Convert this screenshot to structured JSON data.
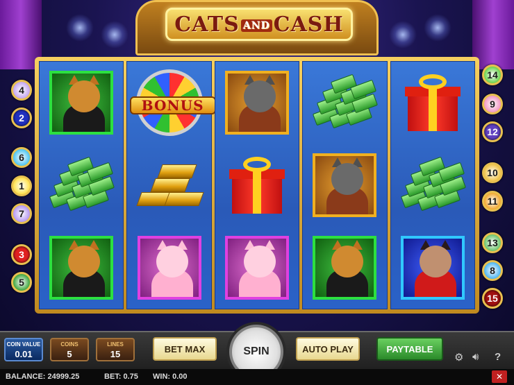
{
  "logo": {
    "part1": "CATS",
    "part2": "AND",
    "part3": "CASH"
  },
  "reels": [
    [
      "tabby-cat-green",
      "cash-stack",
      "tabby-cat-green"
    ],
    [
      "bonus-wheel",
      "gold-bars",
      "fluffy-cat-pink"
    ],
    [
      "grey-cat-gold",
      "gift-box",
      "fluffy-cat-pink"
    ],
    [
      "cash-stack",
      "grey-cat-gold",
      "tabby-cat-green"
    ],
    [
      "gift-box",
      "cash-stack",
      "lady-cat-blue"
    ]
  ],
  "bonus_label": "BONUS",
  "paylines_left": [
    "4",
    "2",
    "6",
    "1",
    "7",
    "3",
    "5"
  ],
  "paylines_right": [
    "14",
    "9",
    "12",
    "10",
    "11",
    "13",
    "8",
    "15"
  ],
  "controls": {
    "coin_value_label": "COIN VALUE",
    "coin_value": "0.01",
    "coins_label": "COINS",
    "coins": "5",
    "lines_label": "LINES",
    "lines": "15",
    "bet_max": "BET MAX",
    "spin": "SPIN",
    "auto_play": "AUTO PLAY",
    "paytable": "PAYTABLE"
  },
  "status": {
    "balance": "BALANCE: 24999.25",
    "bet": "BET: 0.75",
    "win": "WIN: 0.00"
  },
  "icons": {
    "settings": "gear-icon",
    "sound": "speaker-icon",
    "help": "question-icon",
    "close": "close-icon"
  },
  "help_glyph": "?",
  "close_glyph": "✕"
}
